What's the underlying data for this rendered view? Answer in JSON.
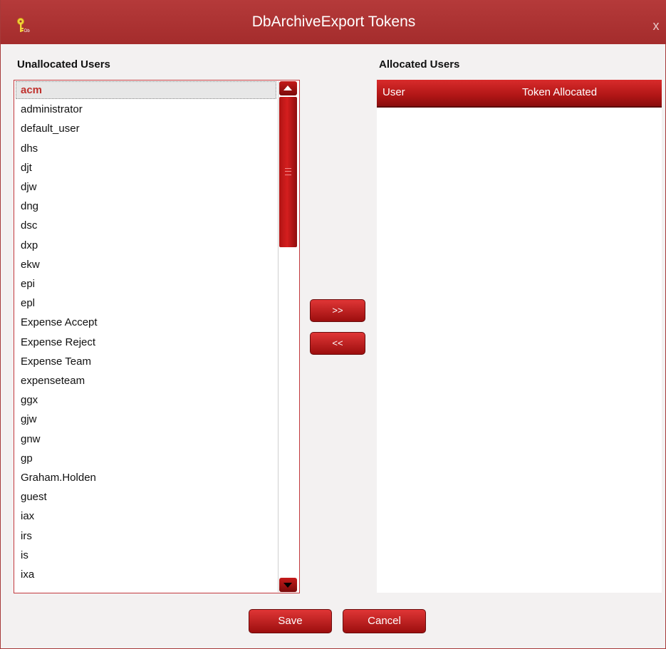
{
  "window": {
    "title": "DbArchiveExport Tokens",
    "close_glyph": "x",
    "icon": "key-icon"
  },
  "unallocated": {
    "label": "Unallocated Users",
    "items": [
      "acm",
      "administrator",
      "default_user",
      "dhs",
      "djt",
      "djw",
      "dng",
      "dsc",
      "dxp",
      "ekw",
      "epi",
      "epl",
      "Expense Accept",
      "Expense Reject",
      "Expense Team",
      "expenseteam",
      "ggx",
      "gjw",
      "gnw",
      "gp",
      "Graham.Holden",
      "guest",
      "iax",
      "irs",
      "is",
      "ixa"
    ],
    "selected": "acm"
  },
  "move_buttons": {
    "add_label": ">>",
    "remove_label": "<<"
  },
  "allocated": {
    "label": "Allocated Users",
    "columns": [
      "User",
      "Token Allocated"
    ],
    "rows": []
  },
  "footer": {
    "save_label": "Save",
    "cancel_label": "Cancel"
  },
  "colors": {
    "accent": "#b01616",
    "title_bar": "#ad3333",
    "selected_text": "#c0322e"
  }
}
